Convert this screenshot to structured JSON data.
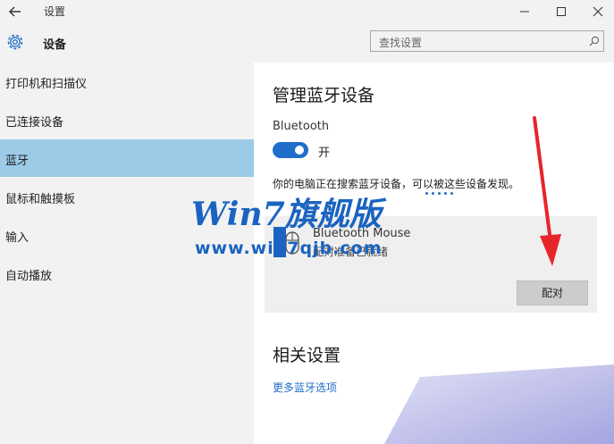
{
  "window": {
    "title": "设置",
    "icons": {
      "back": "back-arrow-icon",
      "minimize": "minimize-icon",
      "maximize": "maximize-icon",
      "close": "close-icon"
    }
  },
  "header": {
    "title": "设备",
    "icon": "gear-icon",
    "search": {
      "placeholder": "查找设置",
      "icon": "search-icon"
    }
  },
  "sidebar": {
    "items": [
      {
        "label": "打印机和扫描仪",
        "selected": false
      },
      {
        "label": "已连接设备",
        "selected": false
      },
      {
        "label": "蓝牙",
        "selected": true
      },
      {
        "label": "鼠标和触摸板",
        "selected": false
      },
      {
        "label": "输入",
        "selected": false
      },
      {
        "label": "自动播放",
        "selected": false
      }
    ],
    "selected_color": "#9ccbe7"
  },
  "main": {
    "title": "管理蓝牙设备",
    "bluetooth_label": "Bluetooth",
    "toggle": {
      "state_label": "开",
      "on": true,
      "color": "#1f6ec9"
    },
    "search_message": "你的电脑正在搜索蓝牙设备，可以被这些设备发现。",
    "device": {
      "name": "Bluetooth Mouse",
      "status": "配对准备已就绪",
      "icon": "mouse-icon",
      "pair_label": "配对"
    },
    "related_title": "相关设置",
    "more_link": "更多蓝牙选项"
  },
  "watermark": {
    "brand": "Win7旗舰版",
    "site": "www.win7qjb.com"
  },
  "annotation": {
    "arrow_color": "#e8242b"
  }
}
